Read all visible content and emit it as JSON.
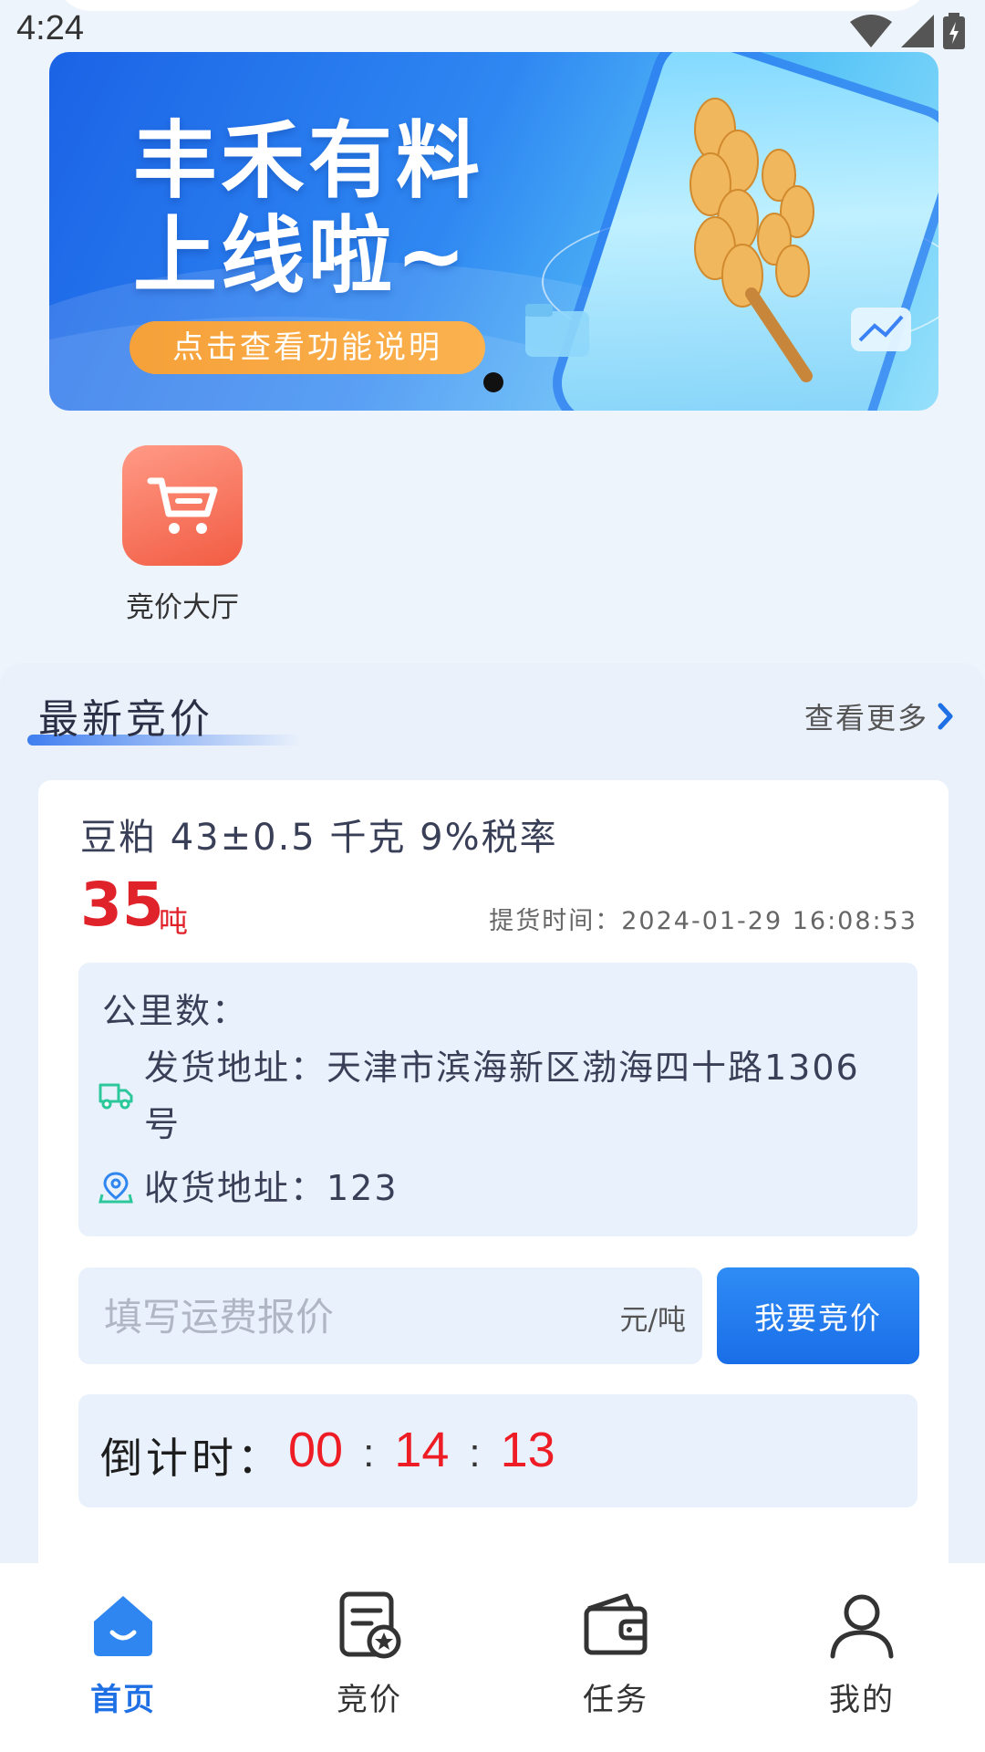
{
  "status_bar": {
    "time": "4:24"
  },
  "banner": {
    "title_line1": "丰禾有料",
    "title_line2": "上线啦~",
    "button_label": "点击查看功能说明"
  },
  "quick_entries": [
    {
      "label": "竞价大厅",
      "icon": "shopping-cart-icon"
    }
  ],
  "section": {
    "title": "最新竞价",
    "more_label": "查看更多"
  },
  "bid_card": {
    "title": "豆粕 43±0.5 千克 9%税率",
    "quantity": "35",
    "quantity_unit": "吨",
    "pickup_time": "提货时间：2024-01-29 16:08:53",
    "distance_label": "公里数：",
    "ship_address_line1": "发货地址：天津市滨海新区渤海四十路1306",
    "ship_address_line2": "号",
    "receive_address": "收货地址：123",
    "price_placeholder": "填写运费报价",
    "price_unit": "元/吨",
    "bid_button": "我要竞价",
    "countdown_label": "倒计时：",
    "countdown": {
      "hours": "00",
      "minutes": "14",
      "seconds": "13"
    },
    "countdown_separator": ":"
  },
  "tabbar": {
    "items": [
      {
        "label": "首页",
        "icon": "home-icon",
        "active": true
      },
      {
        "label": "竞价",
        "icon": "bid-document-icon",
        "active": false
      },
      {
        "label": "任务",
        "icon": "wallet-icon",
        "active": false
      },
      {
        "label": "我的",
        "icon": "user-icon",
        "active": false
      }
    ]
  },
  "colors": {
    "accent": "#1f6fe5",
    "price_red": "#e0232b",
    "countdown_red": "#ee1c24",
    "banner_button": "#f6a13a"
  }
}
